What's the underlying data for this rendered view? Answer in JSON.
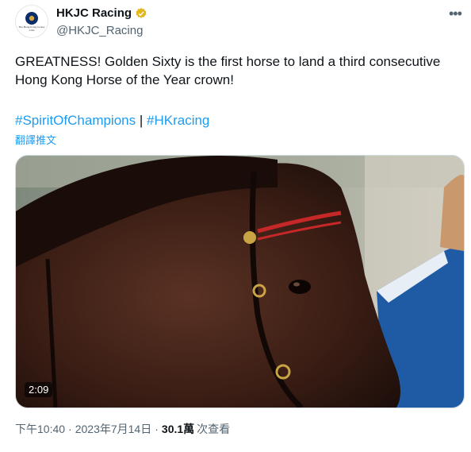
{
  "account": {
    "display_name": "HKJC Racing",
    "handle": "@HKJC_Racing",
    "avatar_caption": "The Hong Kong Jockey Club",
    "verified_icon": "verified-badge-icon"
  },
  "more_icon": "more-icon",
  "tweet": {
    "text": "GREATNESS! Golden Sixty is the first horse to land a third consecutive Hong Kong Horse of the Year crown!",
    "hashtags": [
      "#SpiritOfChampions",
      "#HKracing"
    ],
    "separator": "|",
    "translate_label": "翻譯推文"
  },
  "media": {
    "type": "video",
    "duration": "2:09"
  },
  "meta": {
    "time": "下午10:40",
    "date": "2023年7月14日",
    "views_count": "30.1萬",
    "views_label": "次查看",
    "dot": "·"
  },
  "colors": {
    "accent": "#1d9bf0",
    "verified": "#e2b719",
    "text": "#0f1419",
    "muted": "#536471"
  }
}
